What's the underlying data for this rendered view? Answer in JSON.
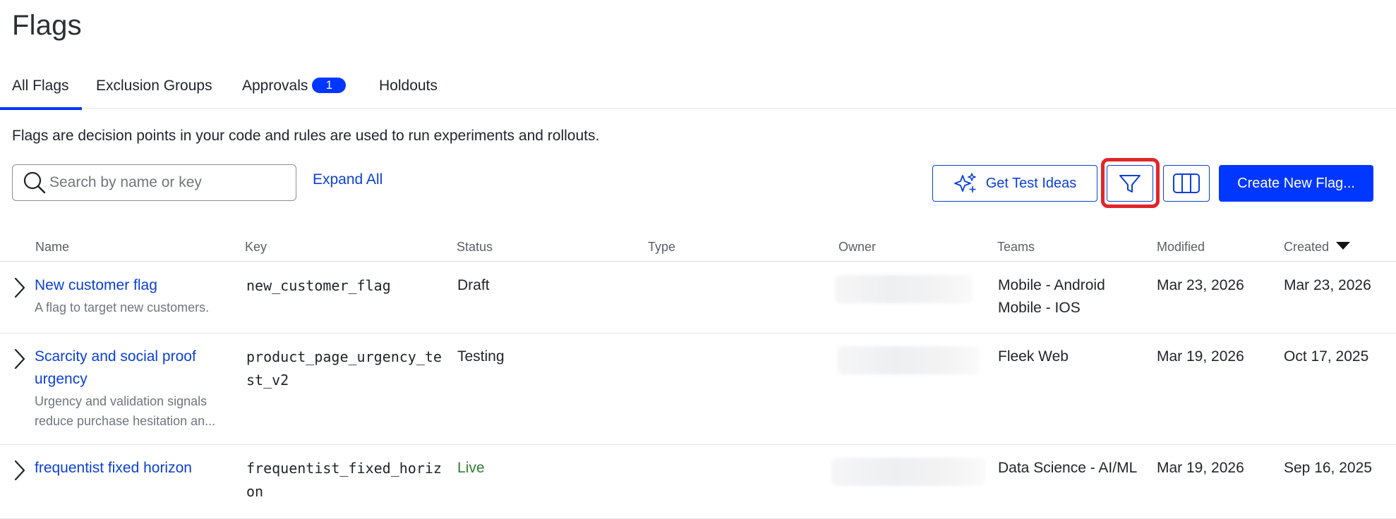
{
  "page": {
    "title": "Flags"
  },
  "tabs": [
    {
      "label": "All Flags",
      "active": true
    },
    {
      "label": "Exclusion Groups",
      "active": false
    },
    {
      "label": "Approvals",
      "badge": "1",
      "active": false
    },
    {
      "label": "Holdouts",
      "active": false
    }
  ],
  "description": "Flags are decision points in your code and rules are used to run experiments and rollouts.",
  "search": {
    "placeholder": "Search by name or key",
    "value": ""
  },
  "toolbar": {
    "expand_all": "Expand All",
    "get_test_ideas": "Get Test Ideas",
    "filter_icon": "filter-icon",
    "columns_icon": "columns-icon",
    "create_new_flag": "Create New Flag..."
  },
  "table": {
    "columns": [
      "Name",
      "Key",
      "Status",
      "Type",
      "Owner",
      "Teams",
      "Modified",
      "Created"
    ],
    "sorted_column": "Created",
    "sort_direction": "descending",
    "rows": [
      {
        "name": "New customer flag",
        "description": "A flag to target new customers.",
        "key": "new_customer_flag",
        "status": "Draft",
        "type": "",
        "teams": [
          "Mobile - Android",
          "Mobile - IOS"
        ],
        "modified": "Mar 23, 2026",
        "created": "Mar 23, 2026"
      },
      {
        "name": "Scarcity and social proof urgency",
        "description": "Urgency and validation signals reduce purchase hesitation an...",
        "key": "product_page_urgency_test_v2",
        "status": "Testing",
        "type": "",
        "teams": [
          "Fleek Web"
        ],
        "modified": "Mar 19, 2026",
        "created": "Oct 17, 2025"
      },
      {
        "name": "frequentist fixed horizon",
        "description": "",
        "key": "frequentist_fixed_horizon",
        "status": "Live",
        "type": "",
        "teams": [
          "Data Science - AI/ML"
        ],
        "modified": "Mar 19, 2026",
        "created": "Sep 16, 2025"
      }
    ]
  },
  "colors": {
    "accent": "#0037ff",
    "link": "#0b3fd8",
    "live": "#2e7d32",
    "highlight": "#e0262b"
  }
}
